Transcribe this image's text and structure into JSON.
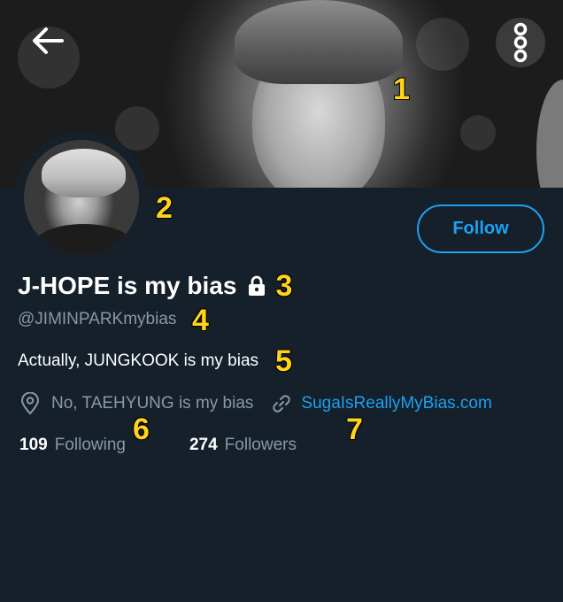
{
  "profile": {
    "display_name": "J-HOPE is my bias",
    "handle": "@JIMINPARKmybias",
    "bio": "Actually, JUNGKOOK is my bias",
    "location": "No, TAEHYUNG is my bias",
    "website": "SugaIsReallyMyBias.com",
    "following_count": "109",
    "following_label": "Following",
    "followers_count": "274",
    "followers_label": "Followers",
    "protected_icon": "lock-icon"
  },
  "header": {
    "back_icon": "arrow-left-icon",
    "more_icon": "more-vertical-icon"
  },
  "actions": {
    "follow_label": "Follow"
  },
  "annotations": [
    "1",
    "2",
    "3",
    "4",
    "5",
    "6",
    "7"
  ],
  "colors": {
    "background": "#15202b",
    "accent": "#1da1f2",
    "secondary_text": "#8899a6",
    "annotation": "#ffd21c"
  }
}
